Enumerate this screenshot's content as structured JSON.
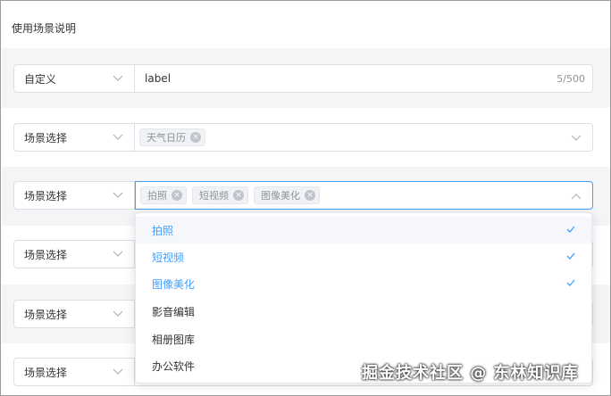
{
  "section_title": "使用场景说明",
  "rows": [
    {
      "select": "自定义",
      "input_value": "label",
      "counter": "5/500"
    },
    {
      "select": "场景选择",
      "tags": [
        "天气日历"
      ]
    },
    {
      "select": "场景选择",
      "tags": [
        "拍照",
        "短视频",
        "图像美化"
      ]
    },
    {
      "select": "场景选择"
    },
    {
      "select": "场景选择"
    },
    {
      "select": "场景选择"
    }
  ],
  "dropdown_options": [
    {
      "label": "拍照",
      "selected": true
    },
    {
      "label": "短视频",
      "selected": true
    },
    {
      "label": "图像美化",
      "selected": true
    },
    {
      "label": "影音编辑",
      "selected": false
    },
    {
      "label": "相册图库",
      "selected": false
    },
    {
      "label": "办公软件",
      "selected": false
    }
  ],
  "tag_close_glyph": "×",
  "watermark": "掘金技术社区 @ 东林知识库",
  "colors": {
    "accent": "#409eff",
    "band": "#f5f5f7",
    "border": "#dcdfe6"
  }
}
